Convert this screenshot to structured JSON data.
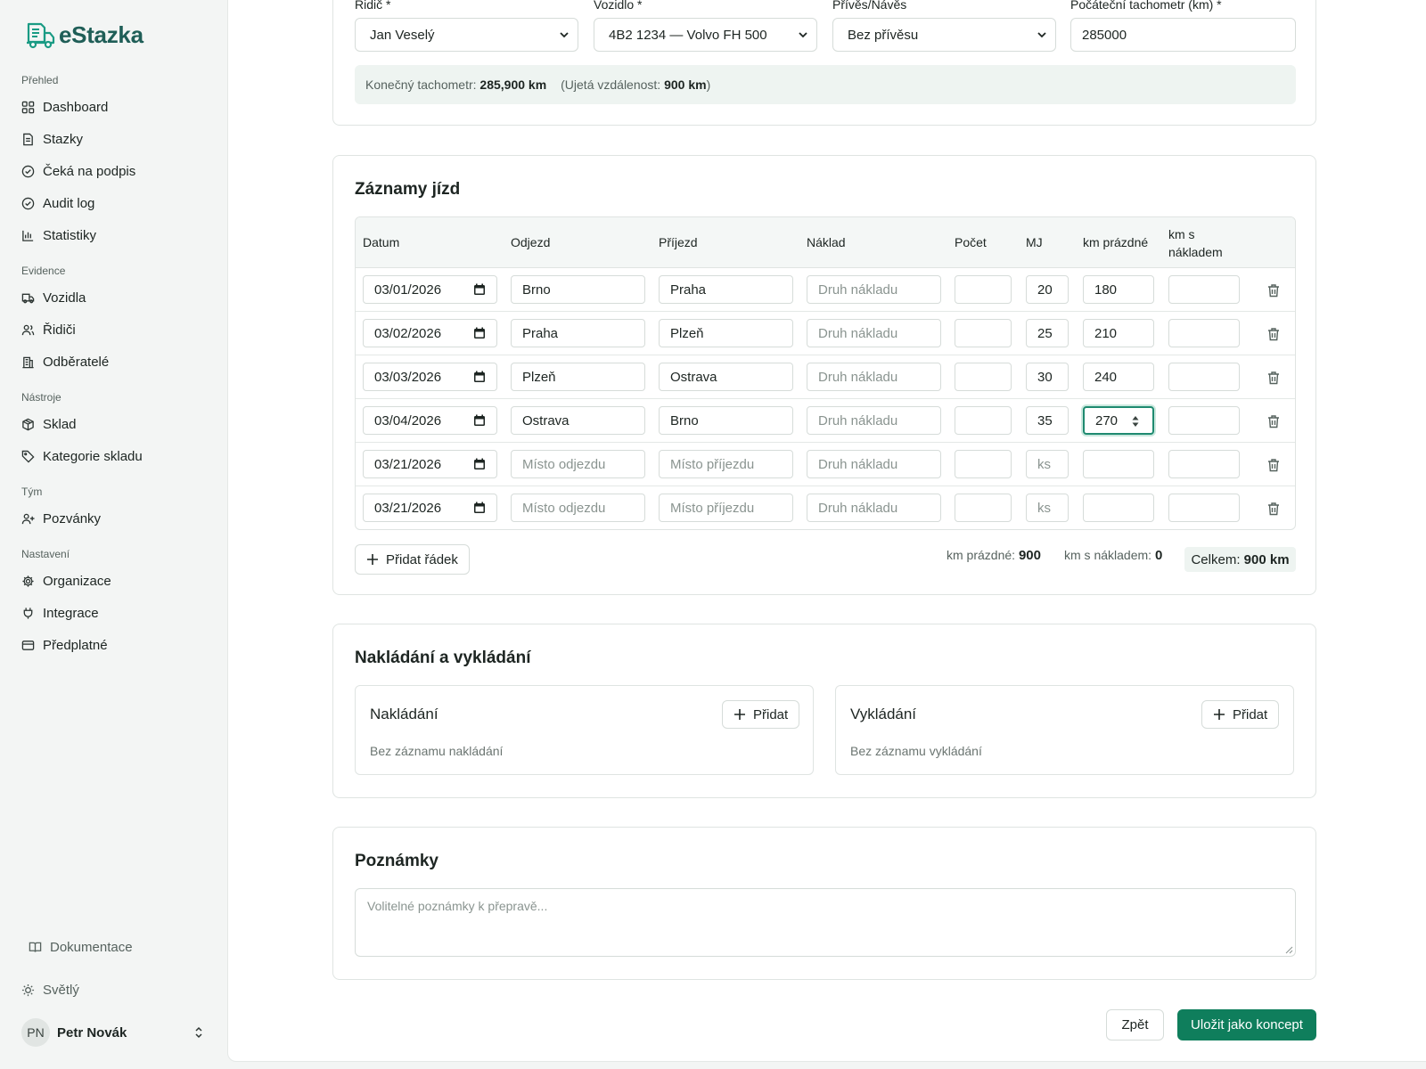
{
  "app": {
    "logo_text": "eStazka"
  },
  "sidebar": {
    "groups": [
      {
        "label": "Přehled",
        "items": [
          {
            "label": "Dashboard",
            "icon": "grid-icon"
          },
          {
            "label": "Stazky",
            "icon": "document-icon"
          },
          {
            "label": "Čeká na podpis",
            "icon": "check-circle-icon"
          },
          {
            "label": "Audit log",
            "icon": "check-circle-icon"
          },
          {
            "label": "Statistiky",
            "icon": "bar-chart-icon"
          }
        ]
      },
      {
        "label": "Evidence",
        "items": [
          {
            "label": "Vozidla",
            "icon": "truck-icon"
          },
          {
            "label": "Řidiči",
            "icon": "users-icon"
          },
          {
            "label": "Odběratelé",
            "icon": "building-icon"
          }
        ]
      },
      {
        "label": "Nástroje",
        "items": [
          {
            "label": "Sklad",
            "icon": "package-icon"
          },
          {
            "label": "Kategorie skladu",
            "icon": "tag-icon"
          }
        ]
      },
      {
        "label": "Tým",
        "items": [
          {
            "label": "Pozvánky",
            "icon": "user-plus-icon"
          }
        ]
      },
      {
        "label": "Nastavení",
        "items": [
          {
            "label": "Organizace",
            "icon": "gear-icon"
          },
          {
            "label": "Integrace",
            "icon": "plug-icon"
          },
          {
            "label": "Předplatné",
            "icon": "credit-card-icon"
          }
        ]
      }
    ],
    "docs_label": "Dokumentace",
    "theme_label": "Světlý",
    "user": {
      "initials": "PN",
      "name": "Petr Novák"
    }
  },
  "header_card": {
    "driver_label": "Řidič *",
    "driver_value": "Jan Veselý",
    "vehicle_label": "Vozidlo *",
    "vehicle_value": "4B2 1234 — Volvo FH 500",
    "trailer_label": "Přívěs/Návěs",
    "trailer_value": "Bez přívěsu",
    "odometer_label": "Počáteční tachometr (km) *",
    "odometer_value": "285000",
    "final_label": "Konečný tachometr:",
    "final_value": "285,900 km",
    "distance_label": "(Ujetá vzdálenost:",
    "distance_value": "900 km",
    "distance_close": ")"
  },
  "trips": {
    "title": "Záznamy jízd",
    "columns": [
      "Datum",
      "Odjezd",
      "Příjezd",
      "Náklad",
      "Počet",
      "MJ",
      "km prázdné",
      "km s nákladem"
    ],
    "placeholders": {
      "departure": "Místo odjezdu",
      "arrival": "Místo příjezdu",
      "cargo": "Druh nákladu",
      "unit": "ks"
    },
    "rows": [
      {
        "date": "03/01/2026",
        "departure": "Brno",
        "arrival": "Praha",
        "cargo": "",
        "count": "",
        "unit": "20",
        "km_empty": "180",
        "km_loaded": ""
      },
      {
        "date": "03/02/2026",
        "departure": "Praha",
        "arrival": "Plzeň",
        "cargo": "",
        "count": "",
        "unit": "25",
        "km_empty": "210",
        "km_loaded": ""
      },
      {
        "date": "03/03/2026",
        "departure": "Plzeň",
        "arrival": "Ostrava",
        "cargo": "",
        "count": "",
        "unit": "30",
        "km_empty": "240",
        "km_loaded": ""
      },
      {
        "date": "03/04/2026",
        "departure": "Ostrava",
        "arrival": "Brno",
        "cargo": "",
        "count": "",
        "unit": "35",
        "km_empty": "270",
        "km_loaded": ""
      },
      {
        "date": "03/21/2026",
        "departure": "",
        "arrival": "",
        "cargo": "",
        "count": "",
        "unit": "",
        "km_empty": "",
        "km_loaded": ""
      },
      {
        "date": "03/21/2026",
        "departure": "",
        "arrival": "",
        "cargo": "",
        "count": "",
        "unit": "",
        "km_empty": "",
        "km_loaded": ""
      }
    ],
    "add_row_label": "Přidat řádek",
    "total_empty_label": "km prázdné:",
    "total_empty_value": "900",
    "total_loaded_label": "km s nákladem:",
    "total_loaded_value": "0",
    "total_label": "Celkem:",
    "total_value": "900 km"
  },
  "loading": {
    "title": "Nakládání a vykládání",
    "loading_title": "Nakládání",
    "loading_empty": "Bez záznamu nakládání",
    "unloading_title": "Vykládání",
    "unloading_empty": "Bez záznamu vykládání",
    "add_label": "Přidat"
  },
  "notes": {
    "title": "Poznámky",
    "placeholder": "Volitelné poznámky k přepravě..."
  },
  "actions": {
    "back_label": "Zpět",
    "save_label": "Uložit jako koncept"
  },
  "colors": {
    "accent": "#0f7e5c",
    "logo": "#1f5e57",
    "info_bg": "#eef4f1"
  }
}
